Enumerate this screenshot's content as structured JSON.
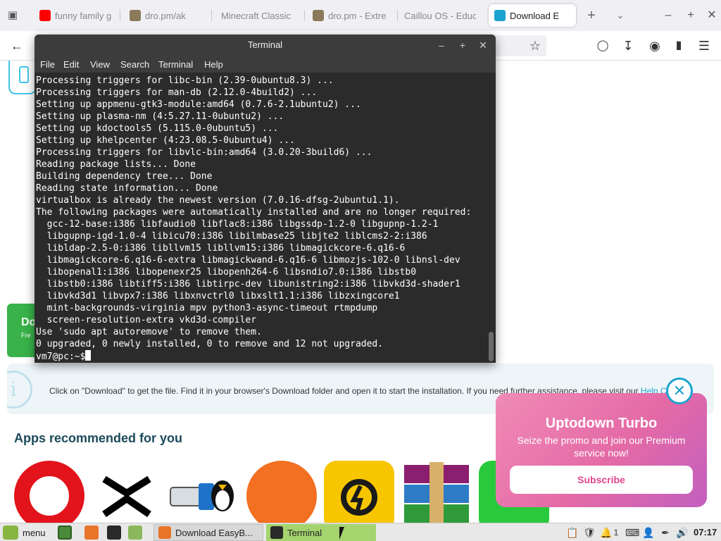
{
  "browser": {
    "tabs": [
      {
        "label": "funny family g",
        "favicon_color": "#ff0000",
        "active": false
      },
      {
        "label": "dro.pm/ak",
        "favicon_color": "#8a7a5a",
        "active": false
      },
      {
        "label": "Minecraft Classic",
        "favicon_color": "",
        "active": false
      },
      {
        "label": "dro.pm - Extre",
        "favicon_color": "#8a7a5a",
        "active": false
      },
      {
        "label": "Caillou OS - Educ",
        "favicon_color": "",
        "active": false
      },
      {
        "label": "Download E",
        "favicon_color": "#1aa3cf",
        "active": true
      }
    ],
    "new_tab_icon": "plus-icon",
    "tab_menu_icon": "chevron-down-icon",
    "window_controls": [
      "minimize-icon",
      "maximize-icon",
      "close-icon"
    ],
    "toolbar_icons": [
      "back-arrow-icon",
      "bookmark-star-icon",
      "pocket-icon",
      "download-icon",
      "account-icon",
      "extensions-icon",
      "hamburger-menu-icon"
    ]
  },
  "page": {
    "download_button": {
      "label": "Do",
      "sub": "Fre"
    },
    "info": {
      "text": "Click on \"Download\" to get the file. Find it in your browser's Download folder and open it to start the installation. If you need further assistance, please visit our ",
      "link": "Help Cen"
    },
    "apps_heading": "Apps recommended for you",
    "apps": [
      {
        "name": "opera-icon",
        "color": "#e3131b"
      },
      {
        "name": "capcut-icon",
        "color": "#000000"
      },
      {
        "name": "usb-tux-icon",
        "color": "#000000"
      },
      {
        "name": "avast-icon",
        "color": "#f36f21"
      },
      {
        "name": "ldplayer-icon",
        "color": "#f7c600"
      },
      {
        "name": "winrar-icon",
        "color": "#8b1e6e"
      },
      {
        "name": "whatsapp-icon",
        "color": "#29c93c"
      }
    ],
    "promo": {
      "title": "Uptodown Turbo",
      "subtitle": "Seize the promo and join our Premium service now!",
      "button": "Subscribe",
      "close_icon": "close-icon"
    }
  },
  "terminal": {
    "title": "Terminal",
    "menu": [
      "File",
      "Edit",
      "View",
      "Search",
      "Terminal",
      "Help"
    ],
    "lines": [
      "Processing triggers for libc-bin (2.39-0ubuntu8.3) ...",
      "Processing triggers for man-db (2.12.0-4build2) ...",
      "Setting up appmenu-gtk3-module:amd64 (0.7.6-2.1ubuntu2) ...",
      "Setting up plasma-nm (4:5.27.11-0ubuntu2) ...",
      "Setting up kdoctools5 (5.115.0-0ubuntu5) ...",
      "Setting up khelpcenter (4:23.08.5-0ubuntu4) ...",
      "Processing triggers for libvlc-bin:amd64 (3.0.20-3build6) ...",
      "Reading package lists... Done",
      "Building dependency tree... Done",
      "Reading state information... Done",
      "virtualbox is already the newest version (7.0.16-dfsg-2ubuntu1.1).",
      "The following packages were automatically installed and are no longer required:",
      "  gcc-12-base:i386 libfaudio0 libflac8:i386 libgssdp-1.2-0 libgupnp-1.2-1",
      "  libgupnp-igd-1.0-4 libicu70:i386 libilmbase25 libjte2 liblcms2-2:i386",
      "  libldap-2.5-0:i386 libllvm15 libllvm15:i386 libmagickcore-6.q16-6",
      "  libmagickcore-6.q16-6-extra libmagickwand-6.q16-6 libmozjs-102-0 libnsl-dev",
      "  libopenal1:i386 libopenexr25 libopenh264-6 libsndio7.0:i386 libstb0",
      "  libstb0:i386 libtiff5:i386 libtirpc-dev libunistring2:i386 libvkd3d-shader1",
      "  libvkd3d1 libvpx7:i386 libxnvctrl0 libxslt1.1:i386 libzxingcore1",
      "  mint-backgrounds-virginia mpv python3-async-timeout rtmpdump",
      "  screen-resolution-extra vkd3d-compiler",
      "Use 'sudo apt autoremove' to remove them.",
      "0 upgraded, 0 newly installed, 0 to remove and 12 not upgraded."
    ],
    "prompt": "vm7@pc:~$"
  },
  "panel": {
    "menu_label": "menu",
    "launchers": [
      "show-desktop-icon",
      "firefox-icon",
      "terminal-icon",
      "files-icon"
    ],
    "tasks": [
      {
        "label": "Download EasyB...",
        "icon": "firefox-icon",
        "active": false
      },
      {
        "label": "Terminal",
        "icon": "terminal-icon",
        "active": true
      }
    ],
    "tray": [
      "clipboard-icon",
      "shield-icon",
      "notifications-icon",
      "keyboard-icon",
      "user-icon",
      "pen-icon",
      "volume-icon"
    ],
    "notification_count": "1",
    "clock": "07:17"
  }
}
